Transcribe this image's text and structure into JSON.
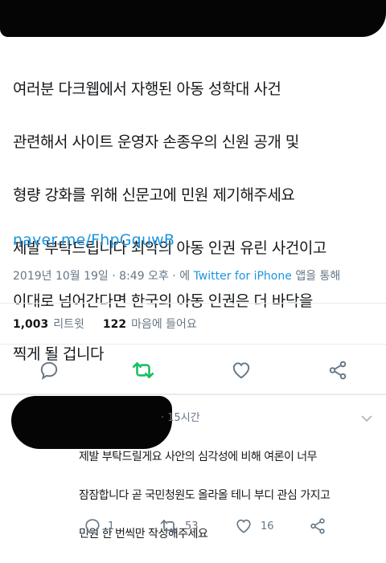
{
  "tweet": {
    "lines": [
      "여러분 다크웹에서 자행된 아동 성학대 사건",
      "관련해서 사이트 운영자 손종우의 신원 공개 및",
      "형량 강화를 위해 신문고에 민원 제기해주세요",
      "제발 부탁드립니다 최악의 아동 인권 유린 사건이고",
      "이대로 넘어간다면 한국의 아동 인권은 더 바닥을",
      "찍게 될 겁니다"
    ],
    "link": "naver.me/FhpGquwB",
    "date": "2019년 10월 19일",
    "time": "8:49 오후",
    "via_prefix": "에",
    "via_app": "Twitter for iPhone",
    "via_suffix": "앱을 통해",
    "retweet_count": "1,003",
    "retweet_label": "리트윗",
    "like_count": "122",
    "like_label": "마음에 들어요"
  },
  "reply": {
    "time": "15시간",
    "lines": [
      "제발 부탁드릴게요 사안의 심각성에 비해 여론이 너무",
      "잠잠합니다 곧 국민청원도 올라올 테니 부디 관심 가지고",
      "민원 한 번씩만 작성해주세요"
    ],
    "reply_count": "1",
    "retweet_count": "53",
    "like_count": "16"
  },
  "colors": {
    "text": "#14171a",
    "secondary": "#657786",
    "link": "#1b95e0",
    "retweeted": "#17bf63",
    "divider": "#e6ecf0"
  },
  "icons": [
    "reply-icon",
    "retweet-icon",
    "like-icon",
    "share-icon",
    "chevron-down-icon"
  ]
}
